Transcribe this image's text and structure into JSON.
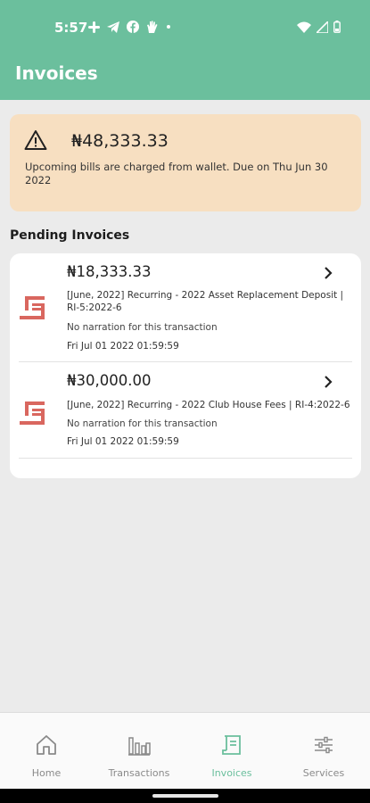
{
  "status_bar": {
    "time": "5:57",
    "icons_left": [
      "slack-icon",
      "telegram-icon",
      "facebook-icon",
      "hand-icon",
      "dot-icon"
    ],
    "icons_right": [
      "wifi-icon",
      "signal-icon",
      "battery-icon"
    ]
  },
  "app_bar": {
    "title": "Invoices",
    "color": "#6bbf9d"
  },
  "alert": {
    "icon": "warning-icon",
    "amount": "₦48,333.33",
    "message": "Upcoming bills are charged from wallet. Due on  Thu Jun 30 2022",
    "background": "#f7dfc1"
  },
  "pending": {
    "title": "Pending Invoices",
    "items": [
      {
        "amount": "₦18,333.33",
        "description": "[June, 2022] Recurring - 2022 Asset Replacement Deposit | RI-5:2022-6",
        "narration": "No narration for this transaction",
        "date": "Fri Jul 01 2022 01:59:59"
      },
      {
        "amount": "₦30,000.00",
        "description": "[June, 2022] Recurring - 2022 Club House Fees | RI-4:2022-6",
        "narration": "No narration for this transaction",
        "date": "Fri Jul 01 2022 01:59:59"
      }
    ],
    "item_icon": "receipt-icon",
    "item_icon_color": "#d9675f"
  },
  "bottom_nav": {
    "items": [
      {
        "label": "Home",
        "icon": "home-icon",
        "active": false
      },
      {
        "label": "Transactions",
        "icon": "bar-chart-icon",
        "active": false
      },
      {
        "label": "Invoices",
        "icon": "invoice-icon",
        "active": true
      },
      {
        "label": "Services",
        "icon": "sliders-icon",
        "active": false
      }
    ]
  }
}
